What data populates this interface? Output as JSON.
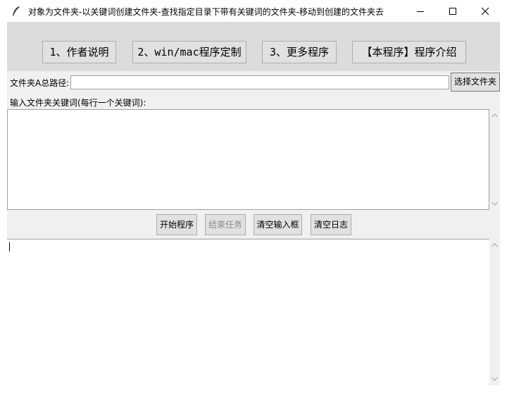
{
  "window": {
    "title": "对象为文件夹-以关键词创建文件夹-查找指定目录下带有关键词的文件夹-移动到创建的文件夹去",
    "icon": "feather-icon",
    "controls": [
      "minimize-icon",
      "maximize-icon",
      "close-icon"
    ]
  },
  "top_buttons": [
    {
      "label": "1、作者说明"
    },
    {
      "label": "2、win/mac程序定制"
    },
    {
      "label": "3、更多程序"
    },
    {
      "label": "【本程序】程序介绍"
    }
  ],
  "path_row": {
    "label": "文件夹A总路径:",
    "value": "",
    "choose_label": "选择文件夹"
  },
  "keywords": {
    "label": "输入文件夹关键词(每行一个关键词):",
    "value": ""
  },
  "actions": {
    "start_label": "开始程序",
    "stop_label": "结束任务",
    "clear_input_label": "清空输入框",
    "clear_log_label": "清空日志"
  },
  "log": {
    "value": ""
  }
}
